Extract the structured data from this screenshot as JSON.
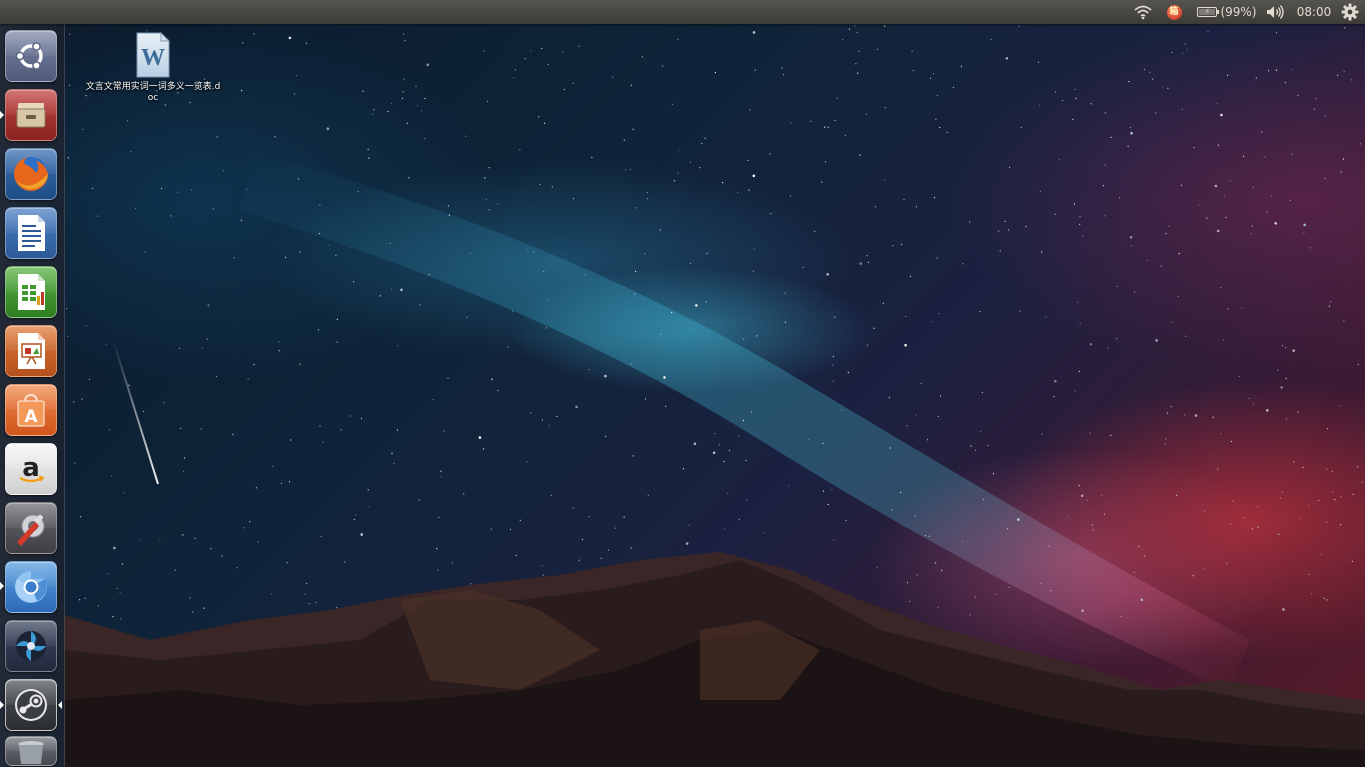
{
  "top_panel": {
    "indicators": [
      {
        "name": "wifi",
        "icon": "wifi-icon"
      },
      {
        "name": "app-indicator",
        "icon": "app-indicator-icon",
        "badge_text": "箱"
      },
      {
        "name": "battery",
        "icon": "battery-icon",
        "text": "(99%)",
        "level_percent": 99
      },
      {
        "name": "volume",
        "icon": "volume-icon"
      },
      {
        "name": "clock",
        "text": "08:00"
      },
      {
        "name": "session",
        "icon": "gear-icon"
      }
    ]
  },
  "launcher": {
    "items": [
      {
        "name": "dash-home",
        "icon": "ubuntu-logo-icon",
        "running": false
      },
      {
        "name": "files",
        "icon": "file-cabinet-icon",
        "running": true
      },
      {
        "name": "firefox",
        "icon": "firefox-icon",
        "running": false
      },
      {
        "name": "libreoffice-writer",
        "icon": "writer-document-icon",
        "running": false
      },
      {
        "name": "libreoffice-calc",
        "icon": "calc-spreadsheet-icon",
        "running": false
      },
      {
        "name": "libreoffice-impress",
        "icon": "impress-presentation-icon",
        "running": false
      },
      {
        "name": "ubuntu-software-center",
        "icon": "shopping-bag-icon",
        "running": false
      },
      {
        "name": "amazon",
        "icon": "amazon-icon",
        "running": false
      },
      {
        "name": "system-settings",
        "icon": "wrench-gear-icon",
        "running": false
      },
      {
        "name": "chromium",
        "icon": "chromium-icon",
        "running": true
      },
      {
        "name": "shutter",
        "icon": "shutter-aperture-icon",
        "running": false
      },
      {
        "name": "steam",
        "icon": "steam-icon",
        "running": true,
        "focused": true
      },
      {
        "name": "trash",
        "icon": "trash-icon",
        "running": false
      }
    ]
  },
  "desktop": {
    "files": [
      {
        "name": "文言文常用实词一词多义一览表.doc",
        "icon": "word-document-icon"
      }
    ]
  },
  "colors": {
    "panel": "#3c3b37",
    "panel_text": "#dfdbd2",
    "launcher_bg": "#282c38"
  }
}
